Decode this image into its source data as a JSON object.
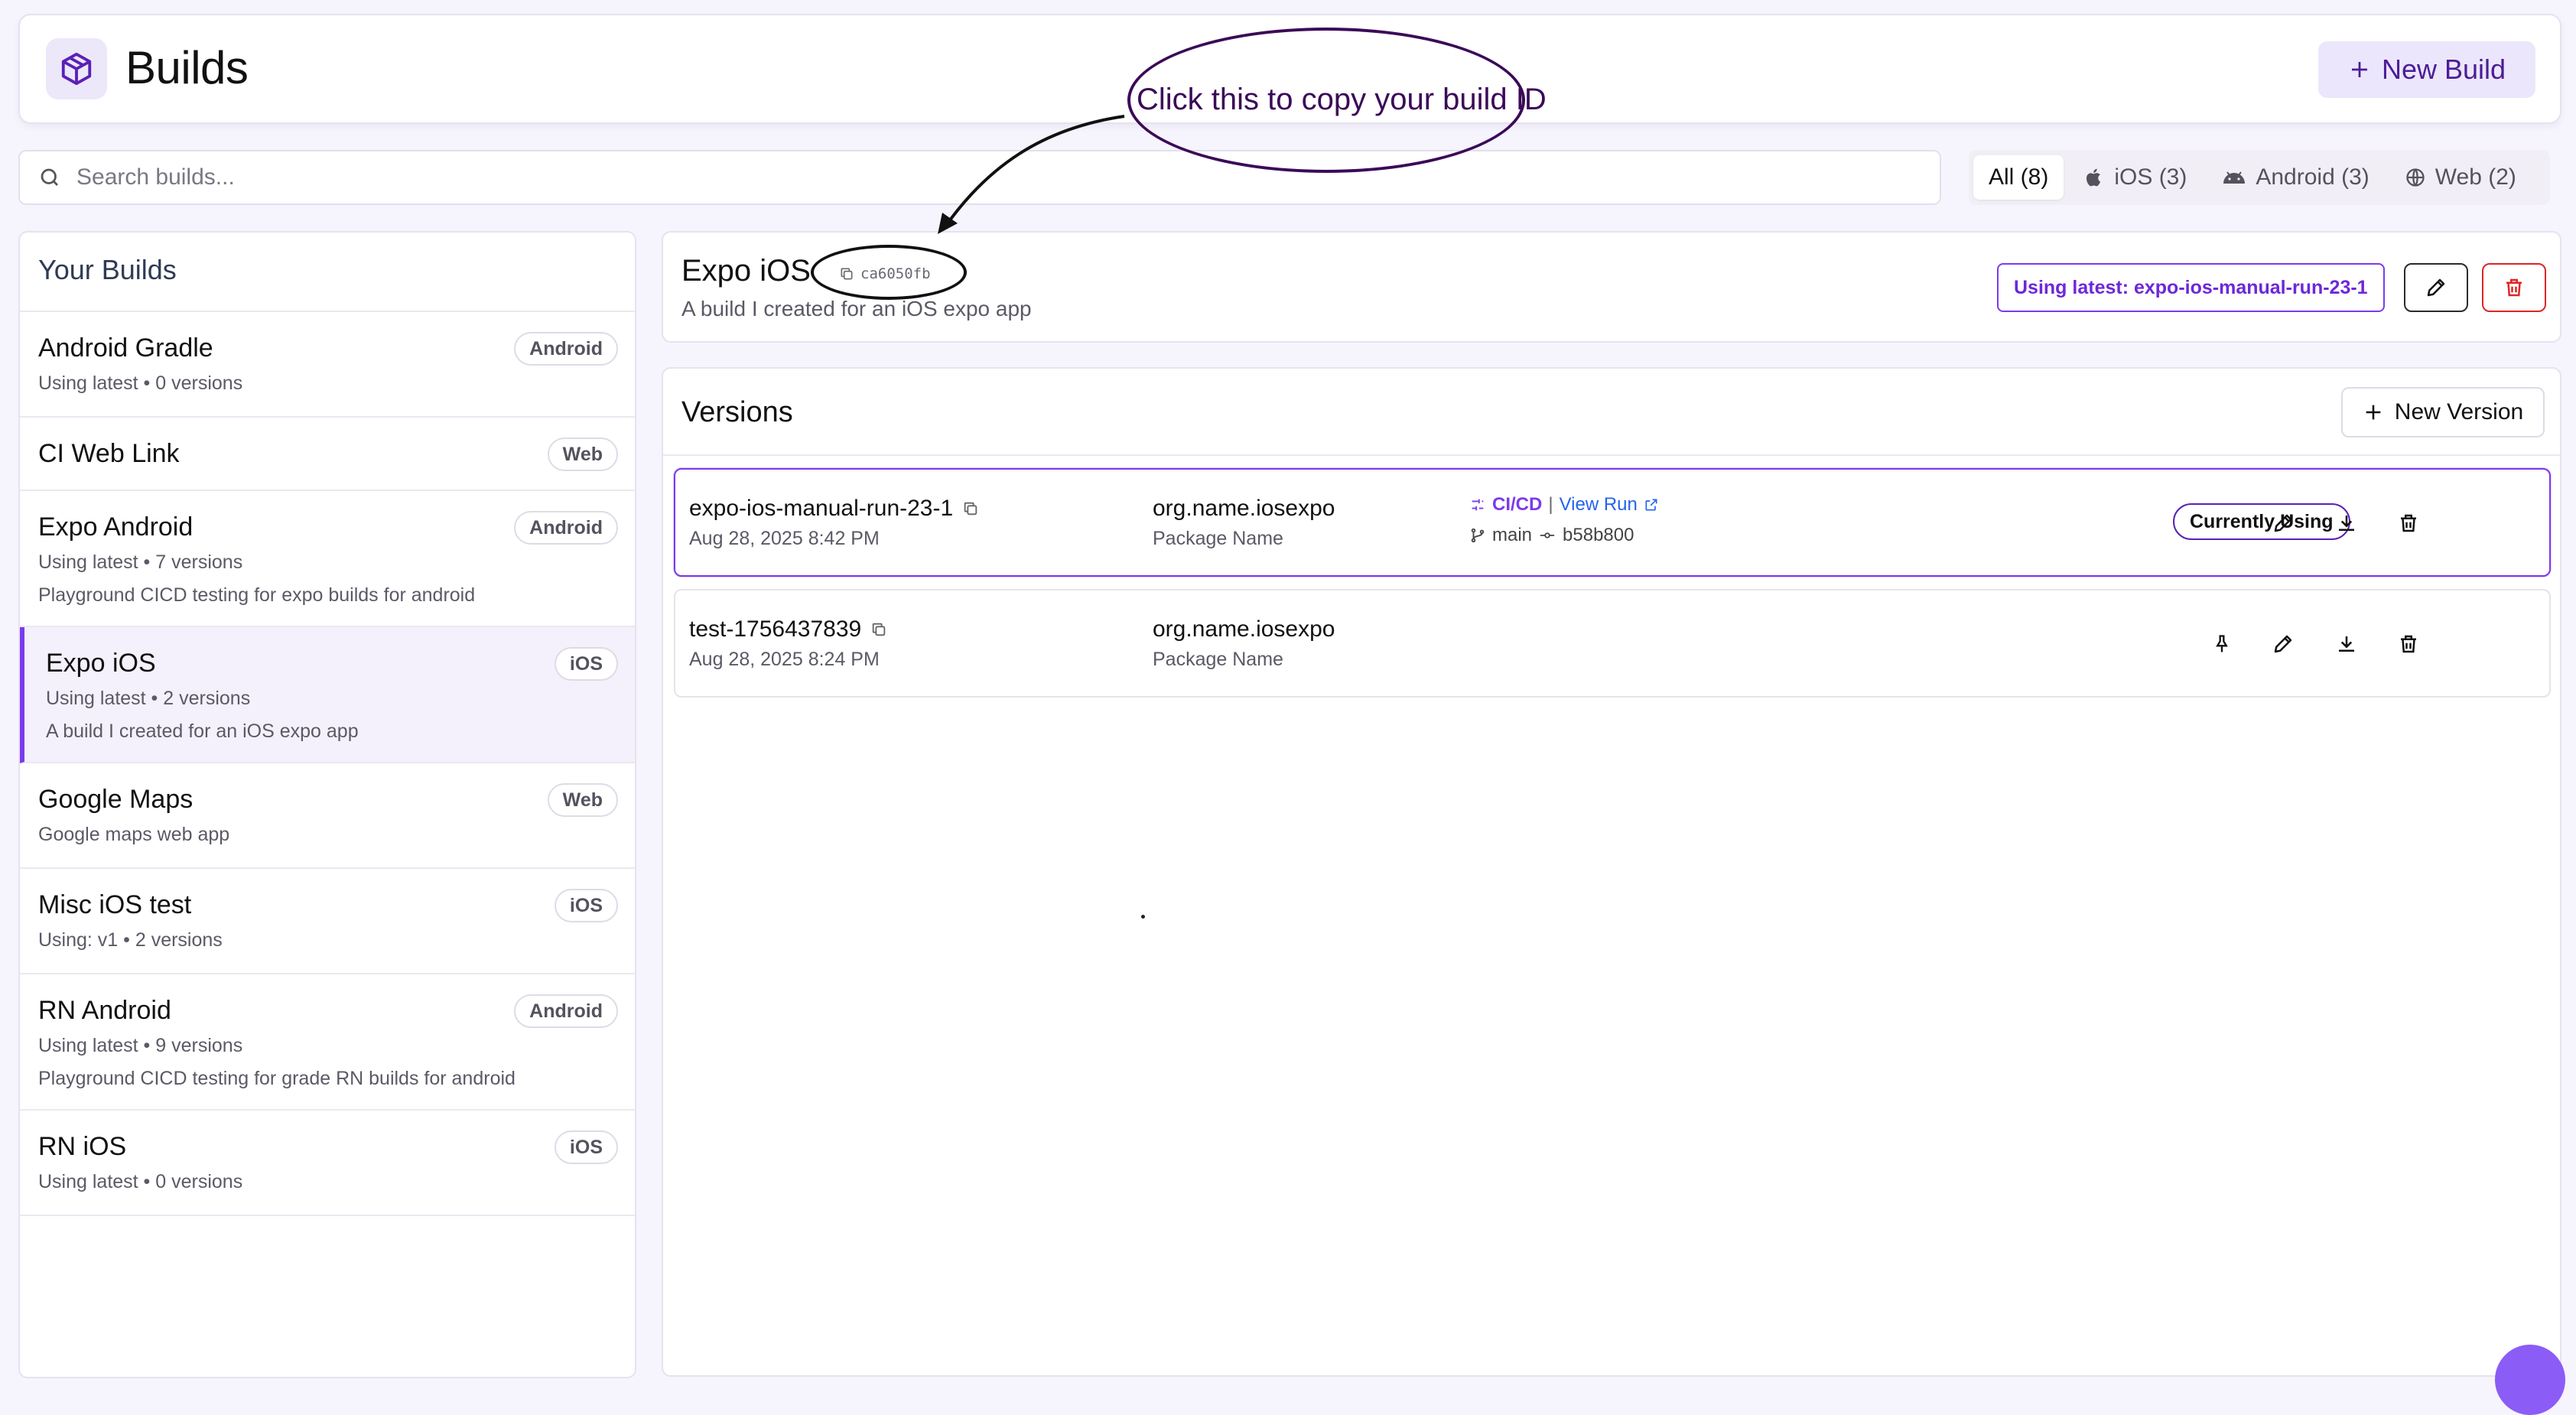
{
  "header": {
    "title": "Builds",
    "new_build_label": "New Build"
  },
  "search": {
    "placeholder": "Search builds..."
  },
  "filters": [
    {
      "label": "All (8)",
      "icon": "none",
      "active": true
    },
    {
      "label": "iOS (3)",
      "icon": "apple-icon",
      "active": false
    },
    {
      "label": "Android (3)",
      "icon": "android-icon",
      "active": false
    },
    {
      "label": "Web (2)",
      "icon": "globe-icon",
      "active": false
    }
  ],
  "sidebar": {
    "title": "Your Builds",
    "items": [
      {
        "name": "Android Gradle",
        "tag": "Android",
        "meta": "Using latest • 0 versions",
        "desc": ""
      },
      {
        "name": "CI Web Link",
        "tag": "Web",
        "meta": "",
        "desc": ""
      },
      {
        "name": "Expo Android",
        "tag": "Android",
        "meta": "Using latest • 7 versions",
        "desc": "Playground CICD testing for expo builds for android"
      },
      {
        "name": "Expo iOS",
        "tag": "iOS",
        "meta": "Using latest • 2 versions",
        "desc": "A build I created for an iOS expo app",
        "selected": true
      },
      {
        "name": "Google Maps",
        "tag": "Web",
        "meta": "",
        "desc": "Google maps web app"
      },
      {
        "name": "Misc iOS test",
        "tag": "iOS",
        "meta": "Using: v1 • 2 versions",
        "desc": ""
      },
      {
        "name": "RN Android",
        "tag": "Android",
        "meta": "Using latest • 9 versions",
        "desc": "Playground CICD testing for grade RN builds for android"
      },
      {
        "name": "RN iOS",
        "tag": "iOS",
        "meta": "Using latest • 0 versions",
        "desc": ""
      }
    ]
  },
  "detail": {
    "title": "Expo iOS",
    "build_id": "ca6050fb",
    "description": "A build I created for an iOS expo app",
    "latest_badge": "Using latest: expo-ios-manual-run-23-1"
  },
  "versions": {
    "title": "Versions",
    "new_version_label": "New Version",
    "rows": [
      {
        "name": "expo-ios-manual-run-23-1",
        "date": "Aug 28, 2025 8:42 PM",
        "package": "org.name.iosexpo",
        "package_label": "Package Name",
        "ci_label": "CI/CD",
        "separator": "|",
        "view_run": "View Run",
        "branch": "main",
        "commit": "b58b800",
        "status": "Currently Using"
      },
      {
        "name": "test-1756437839",
        "date": "Aug 28, 2025 8:24 PM",
        "package": "org.name.iosexpo",
        "package_label": "Package Name"
      }
    ]
  },
  "annotation": {
    "text": "Click this to copy your build ID"
  },
  "colors": {
    "accent": "#7c3aed",
    "danger": "#dc2626",
    "annotation": "#3b0a58"
  }
}
